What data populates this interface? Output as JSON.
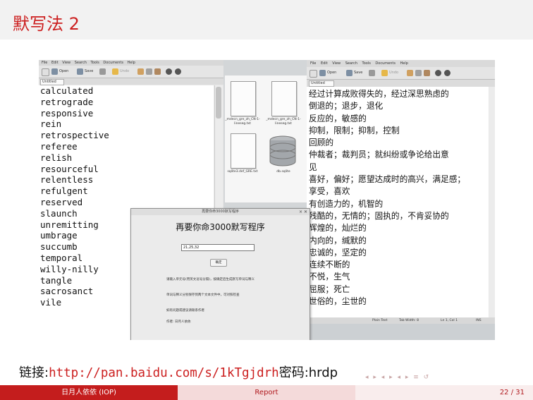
{
  "slide": {
    "title": "默写法 2",
    "link_prefix": "链接:",
    "link_url": "http://pan.baidu.com/s/1kTgjdrh",
    "password_label": "密码:hrdp",
    "nav_symbols": "◂ ▸ ◂ ▸ ◂ ▸ ≡ ↺",
    "colors": {
      "accent": "#cc1f1f",
      "footer_dark": "#c41d1d",
      "footer_light": "#f4dada"
    }
  },
  "left_editor": {
    "menu": [
      "File",
      "Edit",
      "View",
      "Search",
      "Tools",
      "Documents",
      "Help"
    ],
    "toolbar": [
      "Open",
      "Save",
      "Undo"
    ],
    "tab_label": "Untitled",
    "words": [
      "calculated",
      "retrograde",
      "responsive",
      "rein",
      "retrospective",
      "referee",
      "relish",
      "resourceful",
      "relentless",
      "refulgent",
      "reserved",
      "slaunch",
      "unremitting",
      "umbrage",
      "succumb",
      "temporal",
      "willy-nilly",
      "tangle",
      "sacrosanct",
      "vile"
    ]
  },
  "file_browser": {
    "files": [
      {
        "name": "_mdecn_gre_zh_CN-1-lineseg.txt",
        "icon": "document-icon"
      },
      {
        "name": "_mdecn_gre_zh_CN-1-lineseg.txt",
        "icon": "document-icon"
      },
      {
        "name": "sqlite3.def_GRE.txt",
        "icon": "document-icon"
      },
      {
        "name": "db.sqlite",
        "icon": "database-icon"
      }
    ]
  },
  "right_editor": {
    "menu": [
      "File",
      "Edit",
      "View",
      "Search",
      "Tools",
      "Documents",
      "Help"
    ],
    "toolbar": [
      "Open",
      "Save",
      "Undo"
    ],
    "tab_label": "Untitled",
    "lines": [
      "经过计算成败得失的，经过深思熟虑的",
      "倒退的；退步，退化",
      "反应的，敏感的",
      "抑制，限制；抑制，控制",
      "回顾的",
      "仲裁者；裁判员；就纠纷或争论给出意",
      "见",
      "喜好，偏好；愿望达成时的高兴，满足感；",
      "享受，喜欢",
      "有创造力的，机智的",
      "残酷的，无情的；固执的，不肯妥协的",
      "辉煌的，灿烂的",
      "内向的，缄默的",
      "忠诚的，坚定的",
      "连续不断的",
      "不悦，生气",
      "屈服；死亡",
      "世俗的，尘世的"
    ],
    "status": [
      "Plain Text",
      "Tab Width: 8",
      "Ln 1, Col 1",
      "INS"
    ]
  },
  "dialog": {
    "window_title": "再要你命3000默写程序",
    "heading": "再要你命3000默写程序",
    "input_value": "21,25,32",
    "button_label": "确定",
    "instructions": [
      "请输入单元号(用英文逗号分隔)，按确定后生成默写单词与释义",
      "单词与释义分别保存到两个文本文件中，可对照检查",
      "如有问题或建议请联系作者",
      "作者: 日月人依依"
    ]
  },
  "footer": {
    "author": "日月人依依 (IOP)",
    "title": "Report",
    "page": "22 / 31"
  }
}
